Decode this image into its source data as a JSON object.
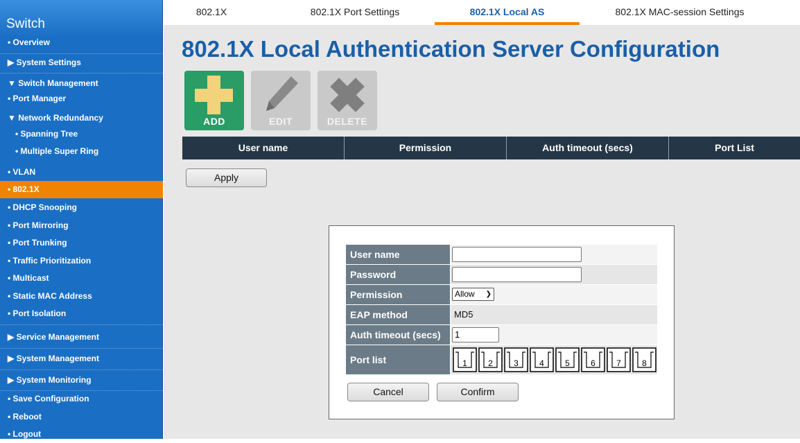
{
  "sidebar": {
    "title": "Switch",
    "items": [
      {
        "label": "• Overview"
      },
      {
        "label": "▶ System Settings"
      },
      {
        "label": "▼ Switch Management"
      },
      {
        "label": "• Port Manager"
      },
      {
        "label": "▼ Network Redundancy"
      },
      {
        "label": "• Spanning Tree"
      },
      {
        "label": "• Multiple Super Ring"
      },
      {
        "label": "• VLAN"
      },
      {
        "label": "• 802.1X"
      },
      {
        "label": "• DHCP Snooping"
      },
      {
        "label": "• Port Mirroring"
      },
      {
        "label": "• Port Trunking"
      },
      {
        "label": "• Traffic Prioritization"
      },
      {
        "label": "• Multicast"
      },
      {
        "label": "• Static MAC Address"
      },
      {
        "label": "• Port Isolation"
      },
      {
        "label": "▶ Service Management"
      },
      {
        "label": "▶ System Management"
      },
      {
        "label": "▶ System Monitoring"
      },
      {
        "label": "• Save Configuration"
      },
      {
        "label": "• Reboot"
      },
      {
        "label": "• Logout"
      }
    ]
  },
  "tabs": [
    {
      "label": "802.1X"
    },
    {
      "label": "802.1X Port Settings"
    },
    {
      "label": "802.1X Local AS"
    },
    {
      "label": "802.1X MAC-session Settings"
    }
  ],
  "page_title": "802.1X Local Authentication Server Configuration",
  "toolbar": {
    "add_label": "ADD",
    "edit_label": "EDIT",
    "delete_label": "DELETE"
  },
  "table": {
    "headers": [
      "User name",
      "Permission",
      "Auth timeout (secs)",
      "Port List"
    ]
  },
  "apply_label": "Apply",
  "dialog": {
    "user_name_label": "User name",
    "user_name_value": "",
    "password_label": "Password",
    "password_value": "",
    "permission_label": "Permission",
    "permission_value": "Allow",
    "eap_label": "EAP method",
    "eap_value": "MD5",
    "timeout_label": "Auth timeout (secs)",
    "timeout_value": "1",
    "portlist_label": "Port list",
    "ports": [
      "1",
      "2",
      "3",
      "4",
      "5",
      "6",
      "7",
      "8"
    ],
    "cancel_label": "Cancel",
    "confirm_label": "Confirm"
  },
  "colors": {
    "accent": "#f08300",
    "sidebar": "#1a6fc4",
    "title": "#1a5fa8",
    "add_button": "#2a9c66",
    "header": "#253746"
  }
}
